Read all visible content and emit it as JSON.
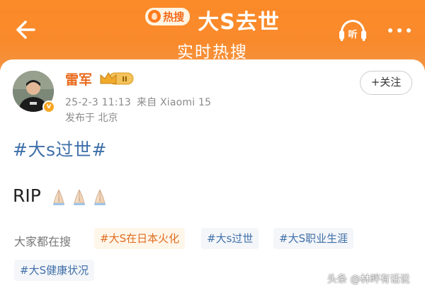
{
  "header": {
    "badge_label": "热搜",
    "topic_title": "大S去世",
    "subtitle": "实时热搜",
    "listen_label": "听",
    "brand_color": "#f98a2c"
  },
  "post": {
    "username": "雷军",
    "level_badge": "II",
    "date": "25-2-3 11:13",
    "source": "来自 Xiaomi 15",
    "location": "发布于 北京",
    "follow_label": "+关注",
    "hashtag": "#大s过世#",
    "text": "RIP",
    "emoji": [
      "🙏🏻",
      "🙏🏻",
      "🙏🏻"
    ]
  },
  "related": {
    "label": "大家都在搜",
    "chips": [
      "#大S在日本火化",
      "#大s过世",
      "#大S职业生涯",
      "#大S健康状况"
    ]
  },
  "watermark": "头条 @林畔有话说"
}
